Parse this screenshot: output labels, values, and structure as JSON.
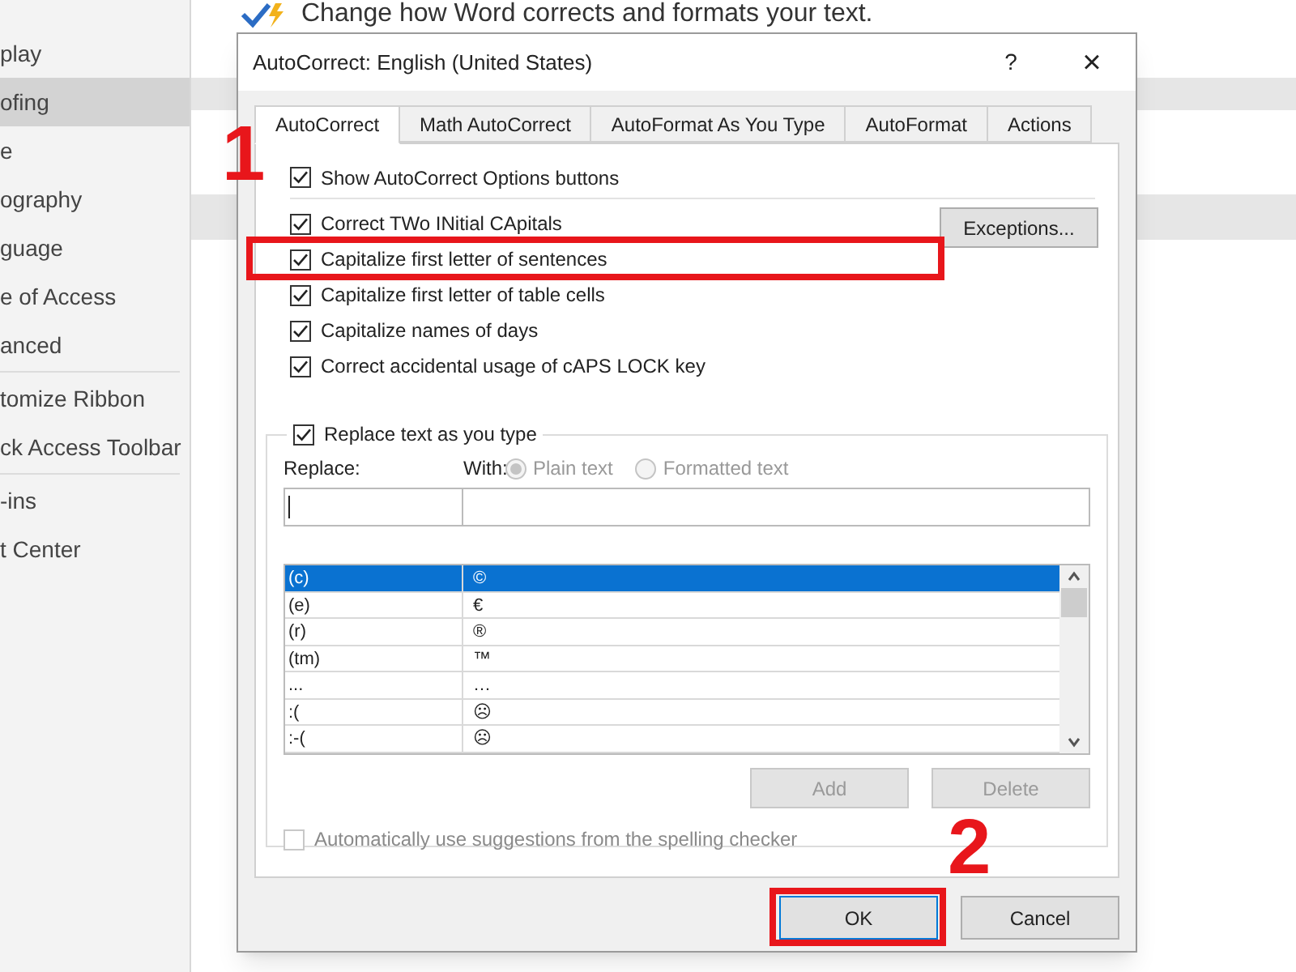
{
  "header": {
    "text": "Change how Word corrects and formats your text."
  },
  "sidebar": {
    "items": [
      {
        "label": "play",
        "selected": false
      },
      {
        "label": "ofing",
        "selected": true
      },
      {
        "label": "e",
        "selected": false
      },
      {
        "label": "ography",
        "selected": false
      },
      {
        "label": "guage",
        "selected": false
      },
      {
        "label": "e of Access",
        "selected": false
      },
      {
        "label": "anced",
        "selected": false
      },
      {
        "label": "tomize Ribbon",
        "selected": false
      },
      {
        "label": "ck Access Toolbar",
        "selected": false
      },
      {
        "label": "-ins",
        "selected": false
      },
      {
        "label": "t Center",
        "selected": false
      }
    ]
  },
  "dialog": {
    "title": "AutoCorrect: English (United States)",
    "help": "?",
    "close": "×",
    "tabs": [
      {
        "label": "AutoCorrect",
        "selected": true
      },
      {
        "label": "Math AutoCorrect",
        "selected": false
      },
      {
        "label": "AutoFormat As You Type",
        "selected": false
      },
      {
        "label": "AutoFormat",
        "selected": false
      },
      {
        "label": "Actions",
        "selected": false
      }
    ],
    "options": [
      {
        "label": "Show AutoCorrect Options buttons",
        "checked": true
      },
      {
        "label": "Correct TWo INitial CApitals",
        "checked": true
      },
      {
        "label": "Capitalize first letter of sentences",
        "checked": true
      },
      {
        "label": "Capitalize first letter of table cells",
        "checked": true
      },
      {
        "label": "Capitalize names of days",
        "checked": true
      },
      {
        "label": "Correct accidental usage of cAPS LOCK key",
        "checked": true
      }
    ],
    "exceptions_button": "Exceptions...",
    "replace_group": {
      "label": "Replace text as you type",
      "checked": true,
      "replace_label": "Replace:",
      "with_label": "With:",
      "radios": [
        {
          "label": "Plain text",
          "selected": true,
          "disabled": true
        },
        {
          "label": "Formatted text",
          "selected": false,
          "disabled": true
        }
      ],
      "rows": [
        {
          "replace": "(c)",
          "with": "©",
          "selected": true
        },
        {
          "replace": "(e)",
          "with": "€",
          "selected": false
        },
        {
          "replace": "(r)",
          "with": "®",
          "selected": false
        },
        {
          "replace": "(tm)",
          "with": "™",
          "selected": false
        },
        {
          "replace": "...",
          "with": "…",
          "selected": false
        },
        {
          "replace": ":(",
          "with": "☹",
          "selected": false
        },
        {
          "replace": ":-(",
          "with": "☹",
          "selected": false
        }
      ]
    },
    "list_buttons": [
      {
        "label": "Add",
        "disabled": true
      },
      {
        "label": "Delete",
        "disabled": true
      }
    ],
    "spelling_option": {
      "label": "Automatically use suggestions from the spelling checker",
      "checked": false,
      "disabled": true
    },
    "buttons": [
      {
        "label": "OK"
      },
      {
        "label": "Cancel"
      }
    ]
  },
  "annotations": [
    {
      "label": "1"
    },
    {
      "label": "2"
    }
  ]
}
